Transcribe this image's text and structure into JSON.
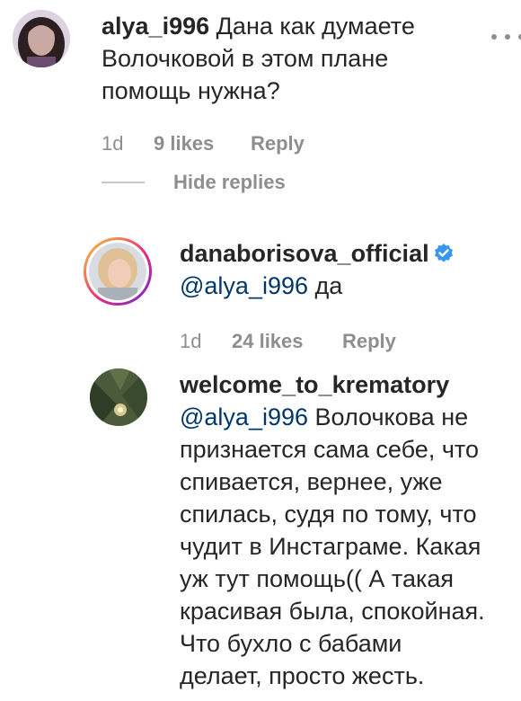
{
  "comments": [
    {
      "username": "alya_i996",
      "text": "Дана как думаете Волочковой в этом плане помощь нужна?",
      "time": "1d",
      "likes": "9 likes",
      "reply": "Reply"
    },
    {
      "username": "danaborisova_official",
      "mention": "@alya_i996",
      "text": "да",
      "time": "1d",
      "likes": "24 likes",
      "reply": "Reply"
    },
    {
      "username": "welcome_to_krematory",
      "mention": "@alya_i996",
      "text_lines": [
        "Волочкова не",
        "признается сама себе, что",
        "спивается, вернее, уже",
        "спилась, судя по тому, что",
        "чудит в Инстаграме. Какая",
        "уж тут помощь(( А такая",
        "красивая была, спокойная.",
        "Что бухло с бабами",
        "делает, просто жесть."
      ]
    }
  ],
  "thread": {
    "hide_replies": "Hide replies"
  },
  "colors": {
    "mention": "#00376b",
    "muted": "#8e8e8e",
    "verified": "#3897f0"
  }
}
